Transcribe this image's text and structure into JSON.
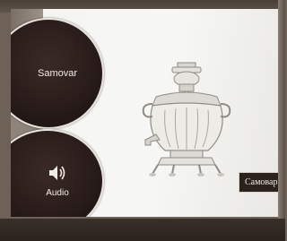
{
  "menu": {
    "samovar_label": "Samovar",
    "audio_label": "Audio"
  },
  "exhibit": {
    "russian_label": "Самовар"
  },
  "icons": {
    "audio": "speaker-icon"
  }
}
